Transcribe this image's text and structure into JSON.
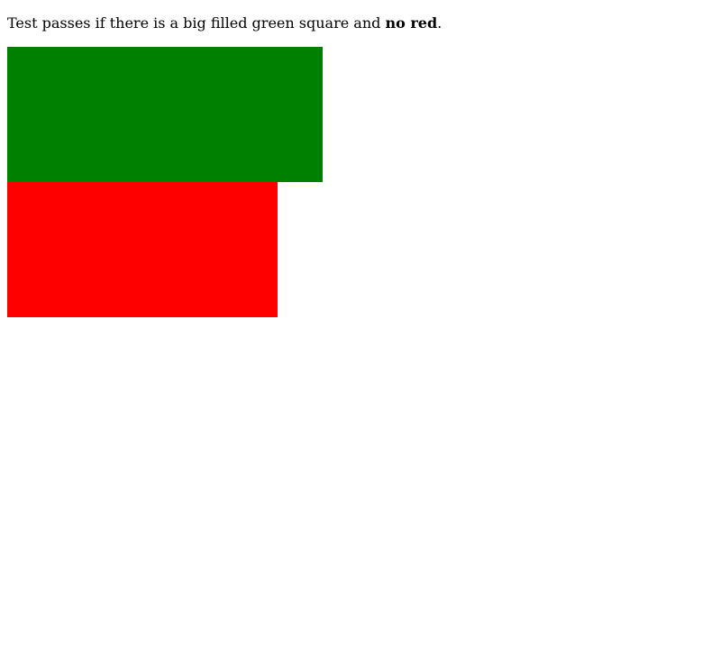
{
  "instruction": {
    "prefix": "Test passes if there is a big filled green square and ",
    "emphasis": "no red",
    "suffix": "."
  },
  "colors": {
    "green_block": "#008000",
    "red_block": "#ff0000",
    "background": "#ffffff",
    "text": "#000000"
  }
}
